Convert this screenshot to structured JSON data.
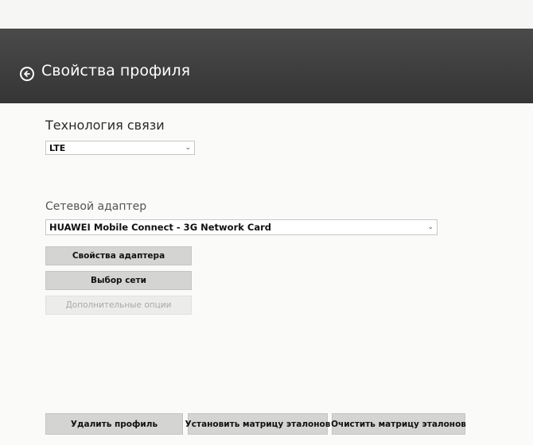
{
  "header": {
    "title": "Свойства профиля",
    "back_icon": "back-arrow-circle-icon"
  },
  "technology": {
    "label": "Технология связи",
    "selected": "LTE"
  },
  "adapter": {
    "label": "Сетевой адаптер",
    "selected": "HUAWEI Mobile Connect - 3G Network Card"
  },
  "buttons": {
    "adapter_properties": "Свойства адаптера",
    "network_select": "Выбор сети",
    "extra_options": "Дополнительные опции",
    "delete_profile": "Удалить профиль",
    "set_matrix": "Установить матрицу эталонов",
    "clear_matrix": "Очистить матрицу эталонов"
  },
  "colors": {
    "header_bg": "#3d3d3d",
    "button_bg": "#d4d4d2",
    "page_bg": "#fafaf8"
  }
}
